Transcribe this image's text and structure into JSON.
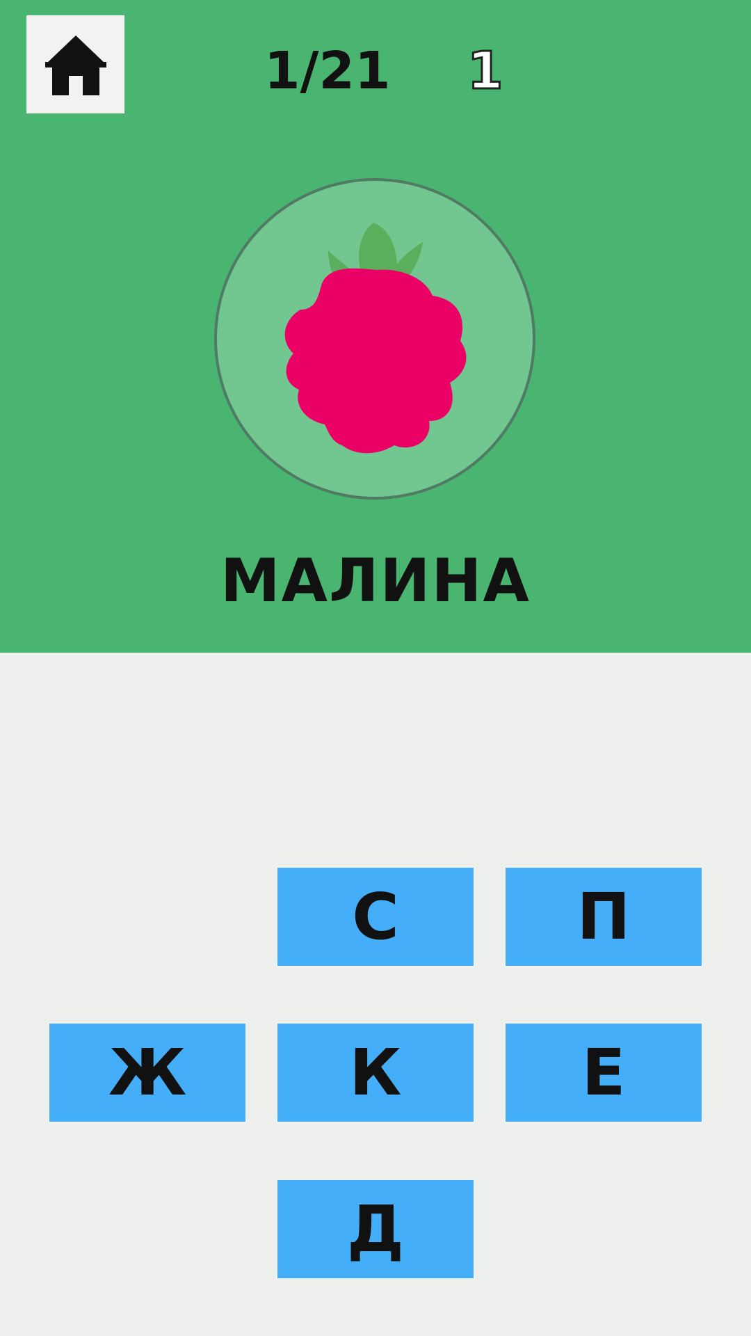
{
  "colors": {
    "top_panel": "#4ab571",
    "bottom_panel": "#eef0ee",
    "tile": "#45aef8",
    "circle": "#72c690",
    "berry": "#eb0066",
    "leaf": "#5aae5c"
  },
  "header": {
    "home_icon": "house-icon",
    "progress": "1/21",
    "score": "1"
  },
  "picture": {
    "icon": "raspberry-icon"
  },
  "word": "МАЛИНА",
  "letters": [
    "С",
    "П",
    "Ж",
    "К",
    "Е",
    "Д"
  ]
}
